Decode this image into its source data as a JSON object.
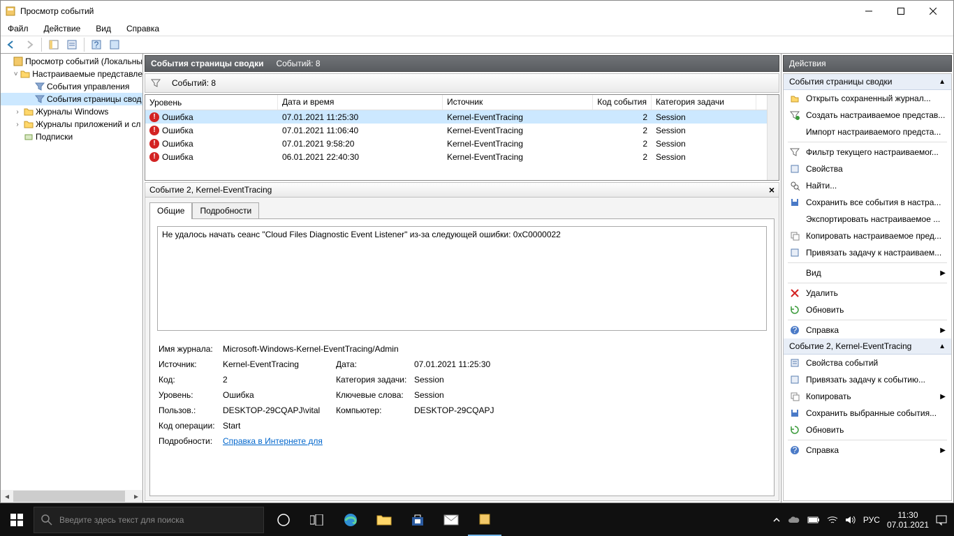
{
  "window": {
    "title": "Просмотр событий"
  },
  "menu": {
    "file": "Файл",
    "action": "Действие",
    "view": "Вид",
    "help": "Справка"
  },
  "tree": {
    "root": "Просмотр событий (Локальны",
    "custom_views": "Настраиваемые представле",
    "admin_events": "События управления",
    "summary_events": "События страницы свод",
    "win_logs": "Журналы Windows",
    "app_logs": "Журналы приложений и сл",
    "subs": "Подписки"
  },
  "center": {
    "header_title": "События страницы сводки",
    "header_count": "Событий: 8",
    "filter_count": "Событий: 8",
    "columns": {
      "level": "Уровень",
      "date": "Дата и время",
      "source": "Источник",
      "code": "Код события",
      "cat": "Категория задачи"
    },
    "rows": [
      {
        "level": "Ошибка",
        "date": "07.01.2021 11:25:30",
        "source": "Kernel-EventTracing",
        "code": "2",
        "cat": "Session"
      },
      {
        "level": "Ошибка",
        "date": "07.01.2021 11:06:40",
        "source": "Kernel-EventTracing",
        "code": "2",
        "cat": "Session"
      },
      {
        "level": "Ошибка",
        "date": "07.01.2021 9:58:20",
        "source": "Kernel-EventTracing",
        "code": "2",
        "cat": "Session"
      },
      {
        "level": "Ошибка",
        "date": "06.01.2021 22:40:30",
        "source": "Kernel-EventTracing",
        "code": "2",
        "cat": "Session"
      }
    ]
  },
  "detail": {
    "header": "Событие 2, Kernel-EventTracing",
    "tab_general": "Общие",
    "tab_details": "Подробности",
    "message": "Не удалось начать сеанс \"Cloud Files Diagnostic Event Listener\" из‑за следующей ошибки: 0xC0000022",
    "labels": {
      "log": "Имя журнала:",
      "source": "Источник:",
      "code": "Код:",
      "level": "Уровень:",
      "user": "Пользов.:",
      "opcode": "Код операции:",
      "more": "Подробности:",
      "date": "Дата:",
      "cat": "Категория задачи:",
      "keywords": "Ключевые слова:",
      "computer": "Компьютер:"
    },
    "values": {
      "log": "Microsoft-Windows-Kernel-EventTracing/Admin",
      "source": "Kernel-EventTracing",
      "date": "07.01.2021 11:25:30",
      "code": "2",
      "cat": "Session",
      "level": "Ошибка",
      "keywords": "Session",
      "user": "DESKTOP-29CQAPJ\\vital",
      "computer": "DESKTOP-29CQAPJ",
      "opcode": "Start",
      "link": "Справка в Интернете для "
    }
  },
  "actions": {
    "title": "Действия",
    "section1": "События страницы сводки",
    "items1": [
      "Открыть сохраненный журнал...",
      "Создать настраиваемое представ...",
      "Импорт настраиваемого предста..."
    ],
    "items1b": [
      "Фильтр текущего настраиваемог...",
      "Свойства",
      "Найти...",
      "Сохранить все события в настра...",
      "Экспортировать настраиваемое ...",
      "Копировать настраиваемое пред...",
      "Привязать задачу к настраиваем..."
    ],
    "items1c": [
      "Вид"
    ],
    "items1d": [
      "Удалить",
      "Обновить"
    ],
    "items1e": [
      "Справка"
    ],
    "section2": "Событие 2, Kernel-EventTracing",
    "items2": [
      "Свойства событий",
      "Привязать задачу к событию...",
      "Копировать",
      "Сохранить выбранные события...",
      "Обновить"
    ],
    "items2b": [
      "Справка"
    ]
  },
  "taskbar": {
    "search_placeholder": "Введите здесь текст для поиска",
    "lang": "РУС",
    "time": "11:30",
    "date": "07.01.2021"
  }
}
